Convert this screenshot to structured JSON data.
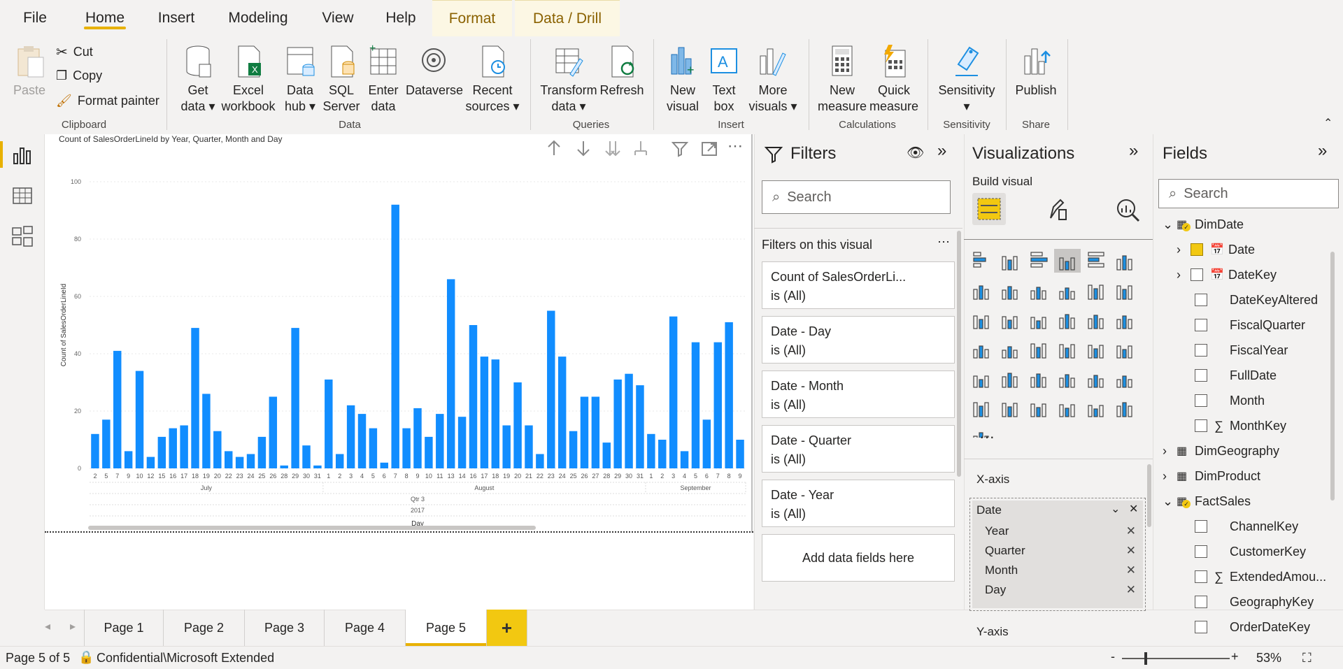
{
  "ribbon_tabs": [
    "File",
    "Home",
    "Insert",
    "Modeling",
    "View",
    "Help",
    "Format",
    "Data / Drill"
  ],
  "active_tab": "Home",
  "clipboard": {
    "paste": "Paste",
    "cut": "Cut",
    "copy": "Copy",
    "format_painter": "Format painter",
    "group": "Clipboard"
  },
  "data_group": {
    "get_data": [
      "Get",
      "data"
    ],
    "excel": [
      "Excel",
      "workbook"
    ],
    "data_hub": [
      "Data",
      "hub"
    ],
    "sql": [
      "SQL",
      "Server"
    ],
    "enter": [
      "Enter",
      "data"
    ],
    "dataverse": "Dataverse",
    "recent": [
      "Recent",
      "sources"
    ],
    "group": "Data"
  },
  "queries": {
    "transform": [
      "Transform",
      "data"
    ],
    "refresh": "Refresh",
    "group": "Queries"
  },
  "insert": {
    "new_visual": [
      "New",
      "visual"
    ],
    "text_box": [
      "Text",
      "box"
    ],
    "more": [
      "More",
      "visuals"
    ],
    "group": "Insert"
  },
  "calculations": {
    "new_measure": [
      "New",
      "measure"
    ],
    "quick_measure": [
      "Quick",
      "measure"
    ],
    "group": "Calculations"
  },
  "sensitivity": {
    "label": "Sensitivity",
    "group": "Sensitivity"
  },
  "share": {
    "publish": "Publish",
    "group": "Share"
  },
  "visual": {
    "title": "Count of SalesOrderLineId by Year, Quarter, Month and Day"
  },
  "chart_data": {
    "type": "bar",
    "title": "Count of SalesOrderLineId by Year, Quarter, Month and Day",
    "ylabel": "Count of SalesOrderLineId",
    "xlabel": "Day",
    "ylim": [
      0,
      100
    ],
    "yticks": [
      0,
      20,
      40,
      60,
      80,
      100
    ],
    "categories": [
      "2",
      "5",
      "7",
      "9",
      "10",
      "12",
      "15",
      "16",
      "17",
      "18",
      "19",
      "20",
      "22",
      "23",
      "24",
      "25",
      "26",
      "28",
      "29",
      "30",
      "31",
      "1",
      "2",
      "3",
      "4",
      "5",
      "6",
      "7",
      "8",
      "9",
      "10",
      "11",
      "13",
      "14",
      "16",
      "17",
      "18",
      "19",
      "20",
      "21",
      "22",
      "23",
      "24",
      "25",
      "26",
      "27",
      "28",
      "29",
      "30",
      "31",
      "1",
      "2",
      "3",
      "4",
      "5",
      "6",
      "7",
      "8",
      "9"
    ],
    "values": [
      12,
      17,
      41,
      6,
      34,
      4,
      11,
      14,
      15,
      49,
      26,
      13,
      6,
      4,
      5,
      11,
      25,
      1,
      49,
      8,
      1,
      31,
      5,
      22,
      19,
      14,
      2,
      92,
      14,
      21,
      11,
      19,
      66,
      18,
      50,
      39,
      38,
      15,
      30,
      15,
      5,
      55,
      39,
      13,
      25,
      25,
      9,
      31,
      33,
      29,
      12,
      10,
      53,
      6,
      44,
      17,
      44,
      51,
      10
    ],
    "months": [
      {
        "name": "July",
        "count": 21
      },
      {
        "name": "August",
        "count": 29
      },
      {
        "name": "September",
        "count": 9
      }
    ],
    "quarter": "Qtr 3",
    "year": "2017"
  },
  "filters": {
    "title": "Filters",
    "search": "Search",
    "section": "Filters on this visual",
    "cards": [
      {
        "name": "Count of SalesOrderLi...",
        "state": "is (All)"
      },
      {
        "name": "Date - Day",
        "state": "is (All)"
      },
      {
        "name": "Date - Month",
        "state": "is (All)"
      },
      {
        "name": "Date - Quarter",
        "state": "is (All)"
      },
      {
        "name": "Date - Year",
        "state": "is (All)"
      }
    ],
    "add": "Add data fields here"
  },
  "visualizations": {
    "title": "Visualizations",
    "build": "Build visual",
    "xaxis": "X-axis",
    "field": "Date",
    "hierarchy": [
      "Year",
      "Quarter",
      "Month",
      "Day"
    ],
    "yaxis": "Y-axis",
    "more": "···"
  },
  "fields": {
    "title": "Fields",
    "search": "Search",
    "items": [
      "DimDate",
      "Date",
      "DateKey",
      "DateKeyAltered",
      "FiscalQuarter",
      "FiscalYear",
      "FullDate",
      "Month",
      "MonthKey",
      "DimGeography",
      "DimProduct",
      "FactSales",
      "ChannelKey",
      "CustomerKey",
      "ExtendedAmou...",
      "GeographyKey",
      "OrderDateKey"
    ]
  },
  "pages": [
    "Page 1",
    "Page 2",
    "Page 3",
    "Page 4",
    "Page 5"
  ],
  "active_page": "Page 5",
  "add_page": "+",
  "status": {
    "page": "Page 5 of 5",
    "sensitivity": "Confidential\\Microsoft Extended",
    "zoom": "53%",
    "minus": "-",
    "plus": "+"
  },
  "accent": "#e8b100",
  "bar_color": "#118dff"
}
